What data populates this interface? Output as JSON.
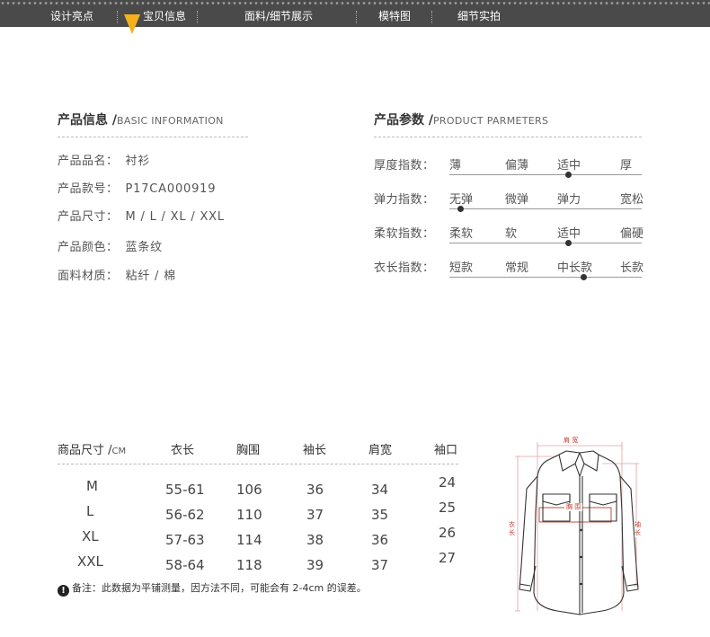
{
  "nav": {
    "items": [
      "设计亮点",
      "宝贝信息",
      "面料/细节展示",
      "模特图",
      "细节实拍"
    ],
    "active_index": 1,
    "bar_color": "#4a4a4a",
    "pointer_color": "#f2b21e"
  },
  "basic_info": {
    "title_cn": "产品信息 /",
    "title_en": "BASIC INFORMATION",
    "rows": [
      {
        "label": "产品品名：",
        "value": "衬衫"
      },
      {
        "label": "产品款号：",
        "value": "P17CA000919"
      },
      {
        "label": "产品尺寸：",
        "value": "M / L / XL / XXL"
      },
      {
        "label": "产品颜色：",
        "value": "蓝条纹"
      },
      {
        "label": "面料材质：",
        "value": "粘纤 / 棉"
      }
    ]
  },
  "parameters": {
    "title_cn": "产品参数 /",
    "title_en": "PRODUCT PARMETERS",
    "rows": [
      {
        "label": "厚度指数：",
        "options": [
          "薄",
          "偏薄",
          "适中",
          "厚"
        ],
        "level": 0.62
      },
      {
        "label": "弹力指数：",
        "options": [
          "无弹",
          "微弹",
          "弹力",
          "宽松"
        ],
        "level": 0.06
      },
      {
        "label": "柔软指数：",
        "options": [
          "柔软",
          "软",
          "适中",
          "偏硬"
        ],
        "level": 0.62
      },
      {
        "label": "衣长指数：",
        "options": [
          "短款",
          "常规",
          "中长款",
          "长款"
        ],
        "level": 0.7
      }
    ]
  },
  "size_table": {
    "header_main": "商品尺寸 /",
    "header_unit": "CM",
    "columns": [
      "衣长",
      "胸围",
      "袖长",
      "肩宽",
      "袖口"
    ],
    "rows": [
      {
        "size": "M",
        "values": [
          "55-61",
          "106",
          "36",
          "34",
          "24"
        ]
      },
      {
        "size": "L",
        "values": [
          "56-62",
          "110",
          "37",
          "35",
          "25"
        ]
      },
      {
        "size": "XL",
        "values": [
          "57-63",
          "114",
          "38",
          "36",
          "26"
        ]
      },
      {
        "size": "XXL",
        "values": [
          "58-64",
          "118",
          "39",
          "37",
          "27"
        ]
      }
    ],
    "note": "备注：此数据为平铺测量，因方法不同，可能会有 2-4cm 的误差。",
    "note_icon_glyph": "!"
  },
  "diagram": {
    "shoulder_label": "肩 宽",
    "chest_label": "胸 围",
    "length_label": "衣\n长",
    "sleeve_label": "袖\n长",
    "measure_color": "#c0392b"
  }
}
